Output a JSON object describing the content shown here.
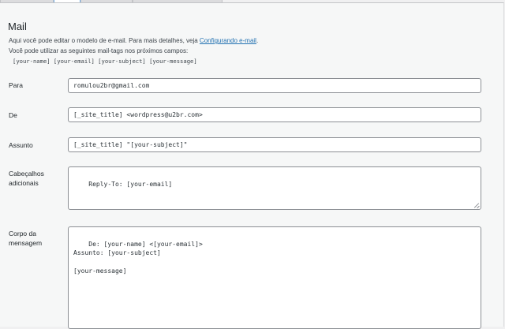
{
  "section": {
    "title": "Mail",
    "description_prefix": "Aqui você pode editar o modelo de e-mail. Para mais detalhes, veja ",
    "description_link": "Configurando e-mail",
    "description_suffix": ".",
    "mailtags_intro": "Você pode utilizar as seguintes mail-tags nos próximos campos:",
    "mailtags": "[your-name] [your-email] [your-subject] [your-message]"
  },
  "fields": {
    "to": {
      "label": "Para",
      "value": "romulou2br@gmail.com"
    },
    "from": {
      "label": "De",
      "value": "[_site_title] <wordpress@u2br.com>"
    },
    "subject": {
      "label": "Assunto",
      "value": "[_site_title] \"[your-subject]\""
    },
    "headers": {
      "label_line1": "Cabeçalhos",
      "label_line2": "adicionais",
      "value": "Reply-To: [your-email]"
    },
    "body": {
      "label_line1": "Corpo da",
      "label_line2": "mensagem",
      "value": "De: [your-name] <[your-email]>\nAssunto: [your-subject]\n\n[your-message]"
    }
  }
}
